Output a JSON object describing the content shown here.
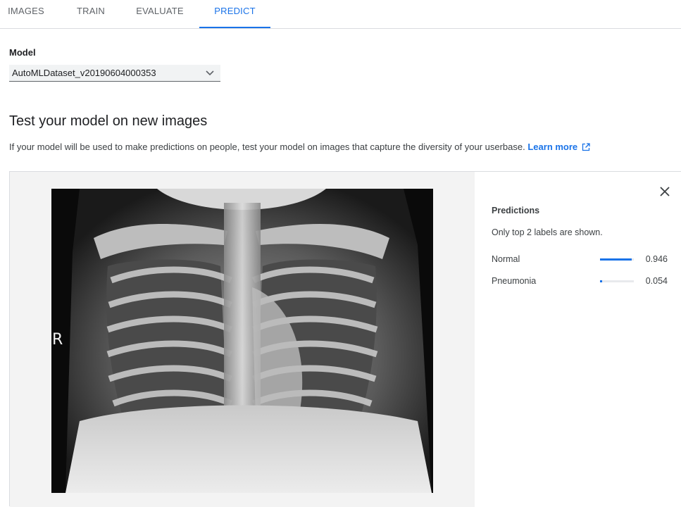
{
  "tabs": [
    {
      "label": "IMAGES",
      "active": false
    },
    {
      "label": "TRAIN",
      "active": false
    },
    {
      "label": "EVALUATE",
      "active": false
    },
    {
      "label": "PREDICT",
      "active": true
    }
  ],
  "model": {
    "label": "Model",
    "selected": "AutoMLDataset_v20190604000353"
  },
  "section": {
    "title": "Test your model on new images",
    "description": "If your model will be used to make predictions on people, test your model on images that capture the diversity of your userbase.",
    "learn_more": "Learn more"
  },
  "image": {
    "marker": "R"
  },
  "predictions": {
    "title": "Predictions",
    "note": "Only top 2 labels are shown.",
    "items": [
      {
        "label": "Normal",
        "score": "0.946",
        "fraction": 0.946
      },
      {
        "label": "Pneumonia",
        "score": "0.054",
        "fraction": 0.054
      }
    ]
  },
  "colors": {
    "accent": "#1a73e8",
    "tab_text": "#5f6368"
  },
  "icons": {
    "dropdown": "chevron-down-icon",
    "external_link": "external-link-icon",
    "close": "close-icon"
  }
}
